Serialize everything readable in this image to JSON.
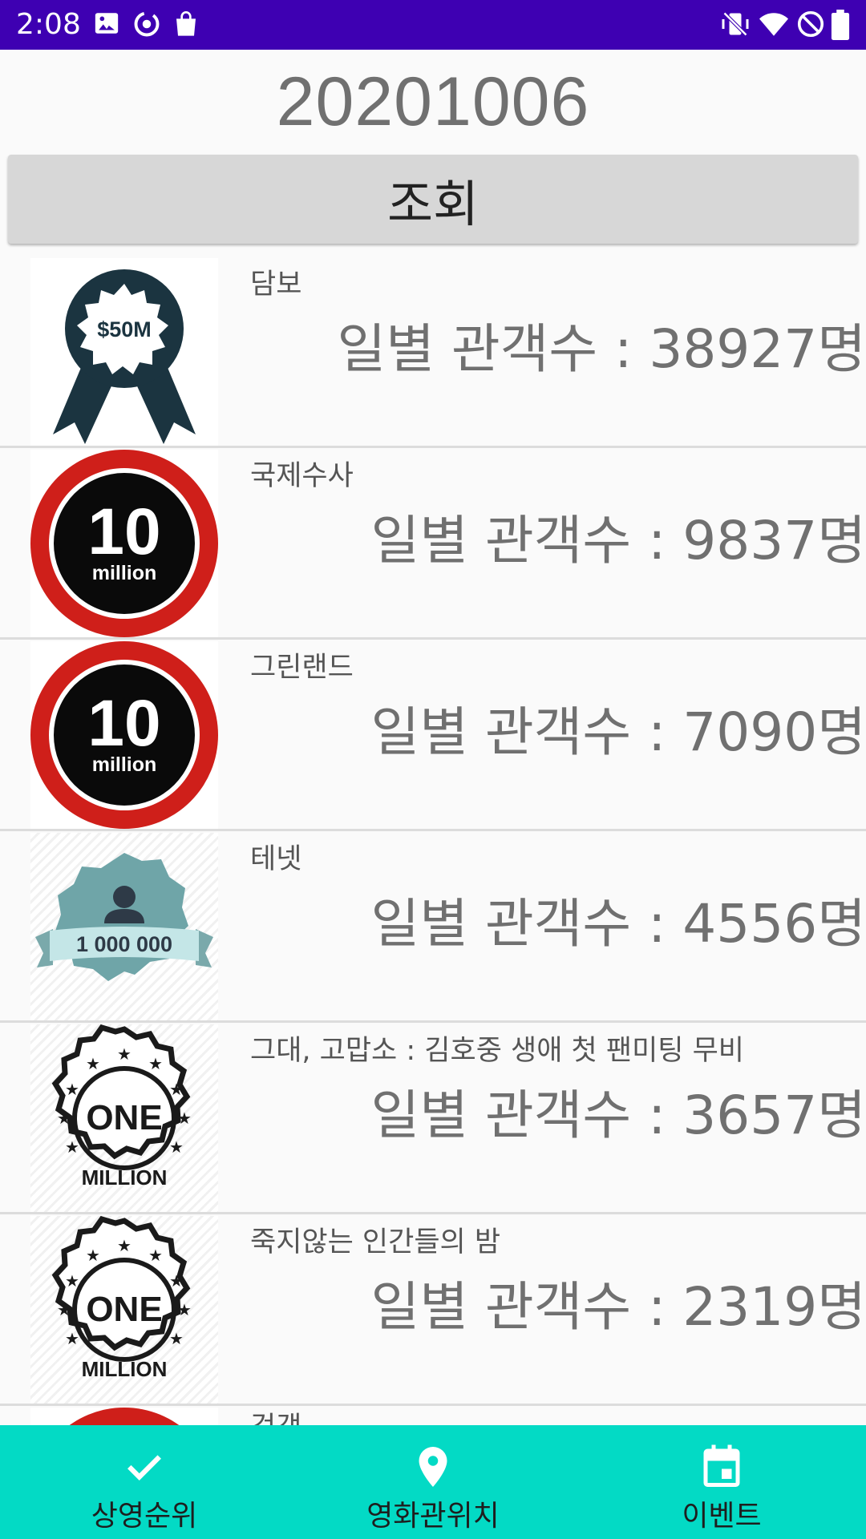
{
  "status_bar": {
    "time": "2:08",
    "left_icons": [
      "image-icon",
      "sync-icon",
      "shopping-bag-icon"
    ],
    "right_icons": [
      "vibrate-off-icon",
      "wifi-icon",
      "do-not-disturb-icon",
      "battery-icon"
    ],
    "bar_color": "#3e00b2"
  },
  "header": {
    "date": "20201006",
    "search_label": "조회"
  },
  "movies": [
    {
      "title": "담보",
      "audience": "일별 관객수 : 38927명",
      "badge": "badge-50m-ribbon-icon",
      "badge_text": "$50M"
    },
    {
      "title": "국제수사",
      "audience": "일별 관객수 : 9837명",
      "badge": "badge-10-million-icon",
      "badge_text": "10",
      "badge_sub": "million"
    },
    {
      "title": "그린랜드",
      "audience": "일별 관객수 : 7090명",
      "badge": "badge-10-million-icon",
      "badge_text": "10",
      "badge_sub": "million"
    },
    {
      "title": "테넷",
      "audience": "일별 관객수 : 4556명",
      "badge": "badge-1000000-users-icon",
      "badge_text": "1 000 000"
    },
    {
      "title": "그대, 고맙소 : 김호중 생애 첫 팬미팅 무비",
      "audience": "일별 관객수 : 3657명",
      "badge": "badge-one-million-icon",
      "badge_text": "ONE",
      "badge_sub": "MILLION"
    },
    {
      "title": "죽지않는 인간들의 밤",
      "audience": "일별 관객수 : 2319명",
      "badge": "badge-one-million-icon",
      "badge_text": "ONE",
      "badge_sub": "MILLION"
    },
    {
      "title": "검객",
      "audience": "",
      "badge": "badge-red-partial-icon"
    }
  ],
  "bottom_nav": {
    "items": [
      {
        "label": "상영순위",
        "icon": "check-icon"
      },
      {
        "label": "영화관위치",
        "icon": "location-pin-icon"
      },
      {
        "label": "이벤트",
        "icon": "calendar-icon"
      }
    ],
    "bar_color": "#03dac5"
  }
}
